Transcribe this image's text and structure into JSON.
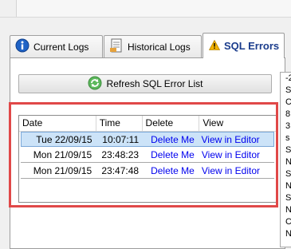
{
  "tabs": [
    {
      "label": "Current Logs",
      "icon": "info-icon",
      "active": false
    },
    {
      "label": "Historical Logs",
      "icon": "document-icon",
      "active": false
    },
    {
      "label": "SQL Errors",
      "icon": "warning-icon",
      "active": true
    }
  ],
  "refresh_button": {
    "label": "Refresh SQL Error List",
    "icon": "refresh-icon"
  },
  "grid": {
    "columns": [
      "Date",
      "Time",
      "Delete",
      "View"
    ],
    "rows": [
      {
        "date": "Tue 22/09/15",
        "time": "10:07:11",
        "delete": "Delete Me",
        "view": "View in Editor",
        "selected": true
      },
      {
        "date": "Mon 21/09/15",
        "time": "23:48:23",
        "delete": "Delete Me",
        "view": "View in Editor",
        "selected": false
      },
      {
        "date": "Mon 21/09/15",
        "time": "23:47:48",
        "delete": "Delete Me",
        "view": "View in Editor",
        "selected": false
      }
    ]
  },
  "side_text": [
    "-2",
    "S",
    "C",
    "8",
    "3",
    "s",
    "S",
    "N",
    "S",
    "N",
    "S",
    "N",
    "C",
    "N"
  ],
  "colors": {
    "accent_tab_text": "#1a3c8c",
    "selection": "#cce3f8",
    "link": "#0000ee",
    "highlight_box": "#e04848"
  }
}
